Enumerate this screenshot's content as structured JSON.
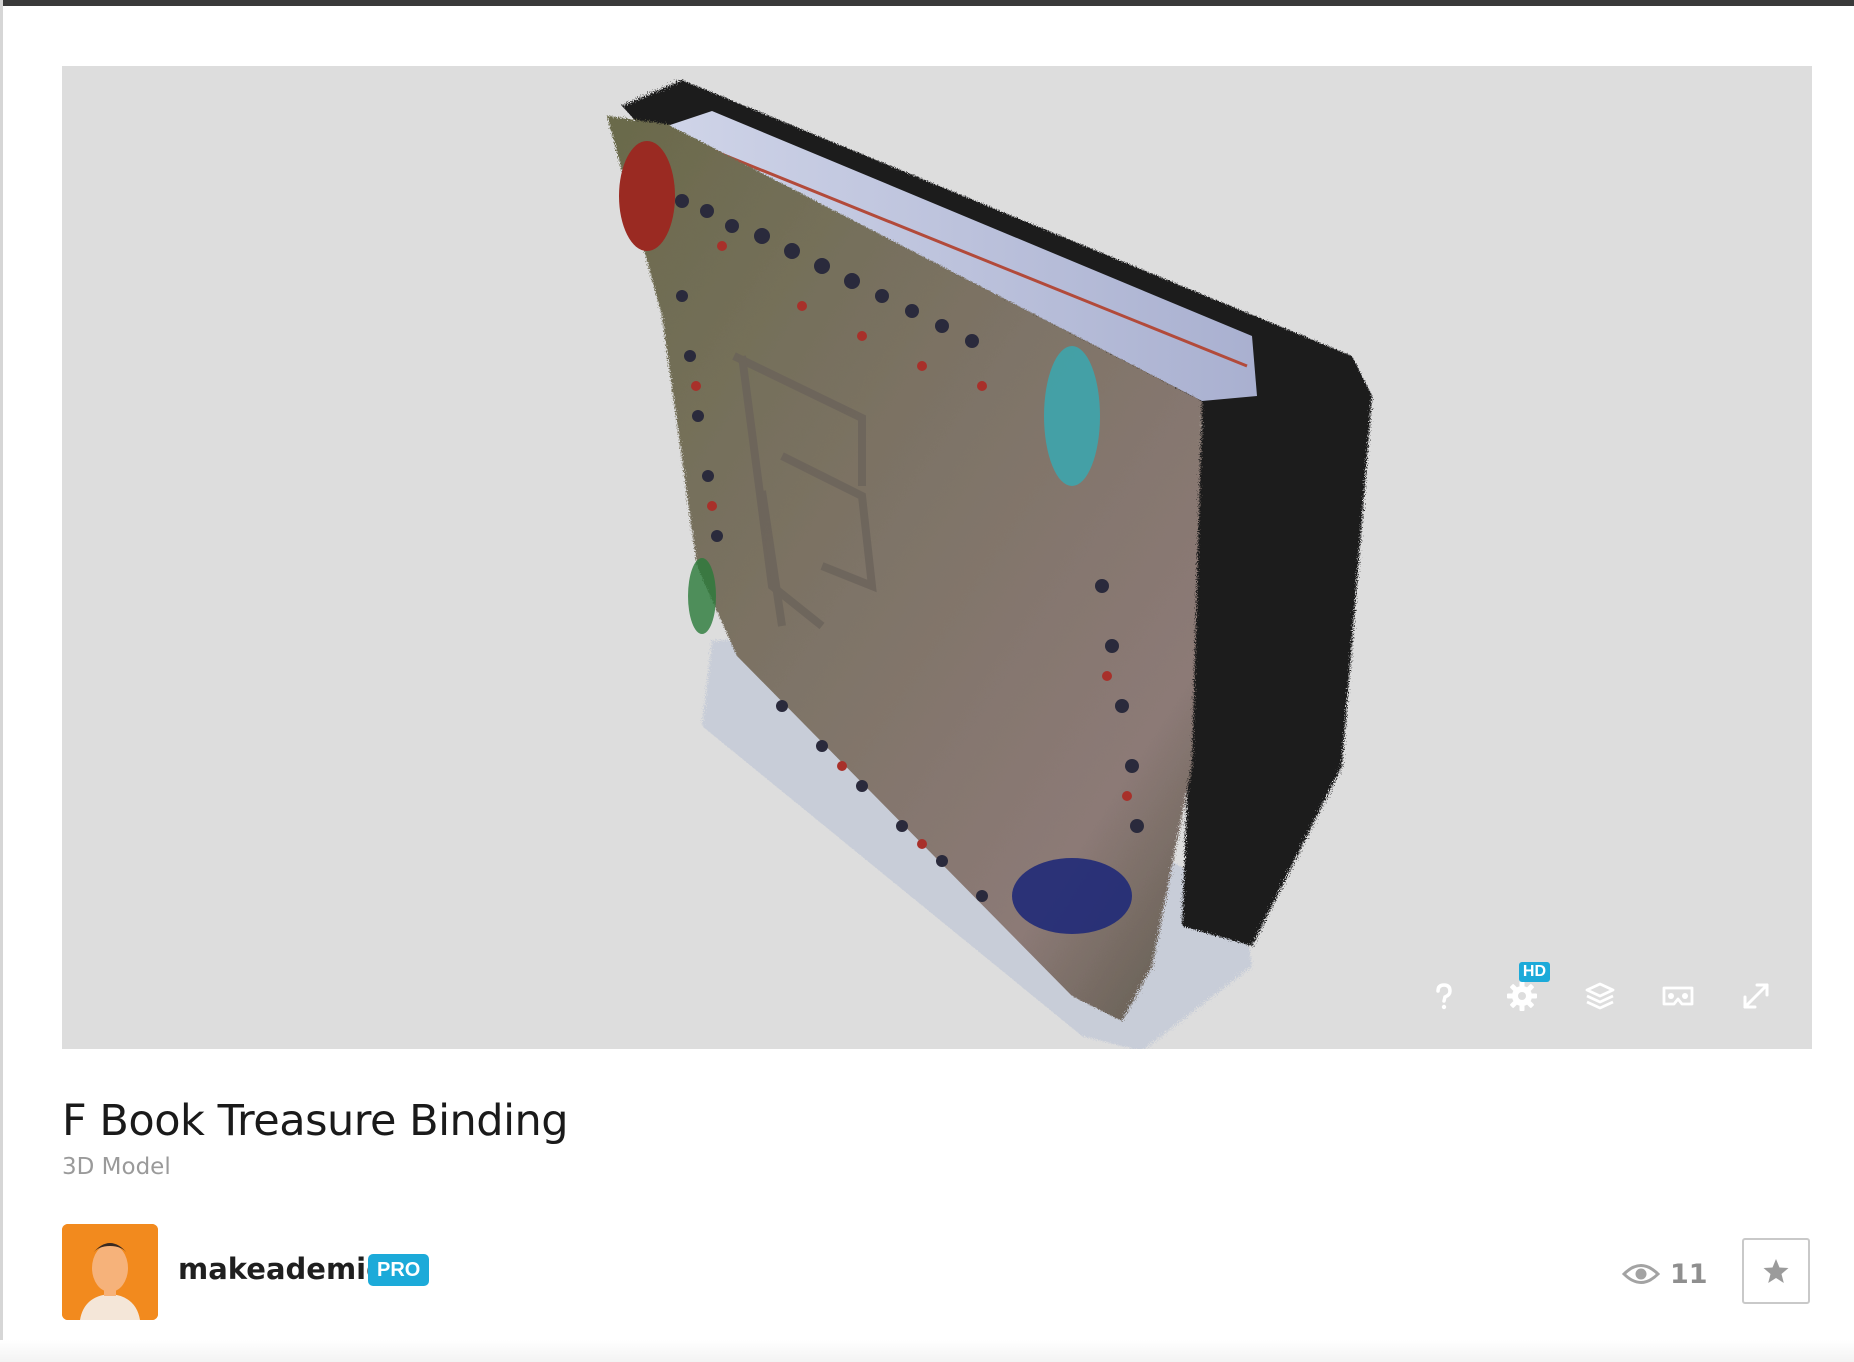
{
  "viewer": {
    "background_color": "#dddddd",
    "controls": [
      {
        "name": "help",
        "icon": "question-mark-icon"
      },
      {
        "name": "settings",
        "icon": "gear-icon",
        "badge": "HD"
      },
      {
        "name": "layers",
        "icon": "layers-icon"
      },
      {
        "name": "vr",
        "icon": "vr-headset-icon"
      },
      {
        "name": "fullscreen",
        "icon": "expand-arrows-icon"
      }
    ]
  },
  "model": {
    "title": "F Book Treasure Binding",
    "type": "3D Model"
  },
  "author": {
    "username": "makeademic",
    "badge": "PRO",
    "avatar_icon": "user-avatar"
  },
  "stats": {
    "views": "11",
    "views_icon": "eye-icon"
  },
  "actions": {
    "like_icon": "star-icon"
  },
  "colors": {
    "accent": "#1caad9",
    "title": "#1a1a1a",
    "muted": "#9a9a9a"
  }
}
